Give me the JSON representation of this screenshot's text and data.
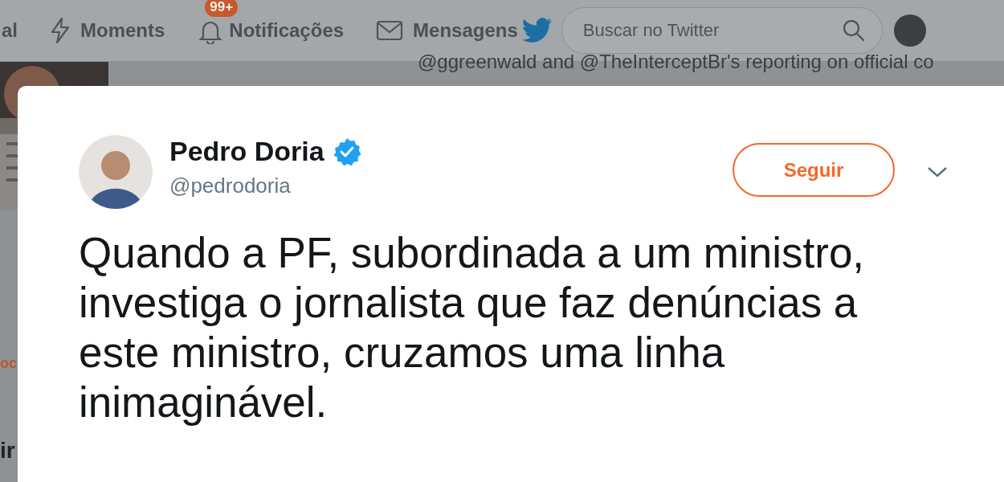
{
  "nav": {
    "items": [
      {
        "label": "al",
        "kind": "plain"
      },
      {
        "label": "Moments",
        "kind": "moments"
      },
      {
        "label": "Notificações",
        "kind": "notifications",
        "badge": "99+"
      },
      {
        "label": "Mensagens",
        "kind": "messages"
      }
    ],
    "search": {
      "placeholder": "Buscar no Twitter"
    }
  },
  "background": {
    "side_texts": [
      {
        "text": "oc",
        "kind": "link"
      },
      {
        "text": "ir",
        "kind": "heading"
      }
    ],
    "tweet_line": "@ggreenwald and @TheInterceptBr's reporting on official co"
  },
  "tweet": {
    "name": "Pedro Doria",
    "verified": true,
    "handle": "@pedrodoria",
    "follow_button": "Seguir",
    "text": "Quando a PF, subordinada a um ministro, investiga o jornalista que faz denúncias a este ministro, cruzamos uma linha inimaginável."
  }
}
